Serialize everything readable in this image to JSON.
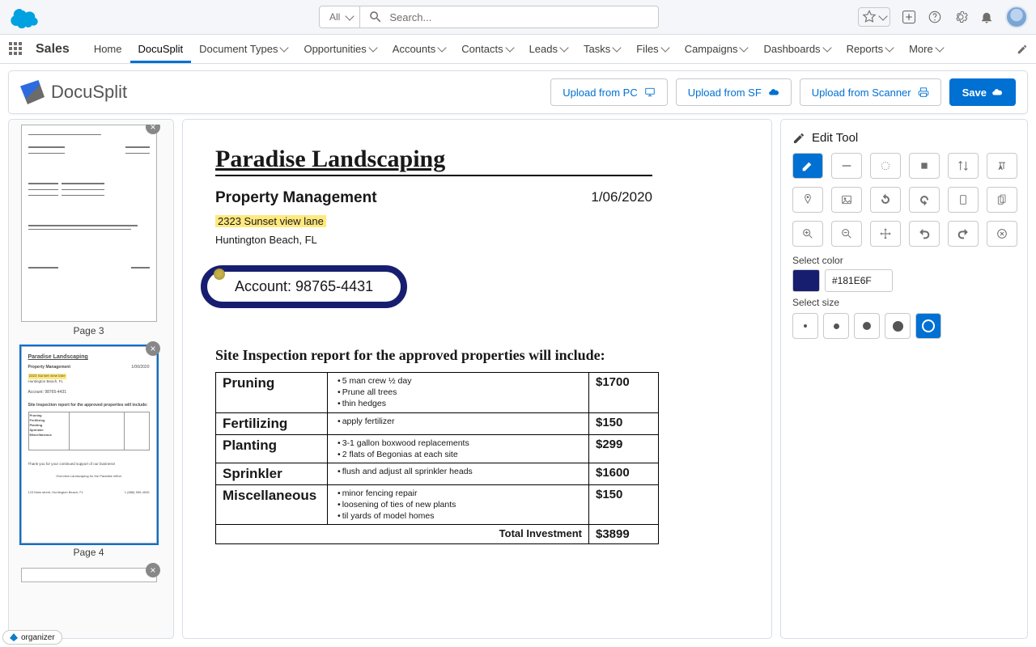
{
  "header": {
    "search_scope": "All",
    "search_placeholder": "Search..."
  },
  "nav": {
    "app": "Sales",
    "tabs": [
      "Home",
      "DocuSplit",
      "Document Types",
      "Opportunities",
      "Accounts",
      "Contacts",
      "Leads",
      "Tasks",
      "Files",
      "Campaigns",
      "Dashboards",
      "Reports",
      "More"
    ],
    "active": "DocuSplit",
    "with_caret": [
      "Document Types",
      "Opportunities",
      "Accounts",
      "Contacts",
      "Leads",
      "Tasks",
      "Files",
      "Campaigns",
      "Dashboards",
      "Reports",
      "More"
    ]
  },
  "appbar": {
    "name": "DocuSplit",
    "upload_pc": "Upload from PC",
    "upload_sf": "Upload from SF",
    "upload_scan": "Upload from Scanner",
    "save": "Save"
  },
  "thumbs": {
    "pages": [
      {
        "caption": "Page 3"
      },
      {
        "caption": "Page 4"
      }
    ]
  },
  "document": {
    "title": "Paradise Landscaping",
    "subtitle": "Property Management",
    "date": "1/06/2020",
    "address_line1": "2323 Sunset view lane",
    "address_line2": "Huntington Beach, FL",
    "account": "Account: 98765-4431",
    "report_heading": "Site Inspection report for the approved properties will include:",
    "rows": [
      {
        "label": "Pruning",
        "details": [
          "5 man crew ½ day",
          "Prune all trees",
          "thin hedges"
        ],
        "price": "$1700"
      },
      {
        "label": "Fertilizing",
        "details": [
          "apply fertilizer"
        ],
        "price": "$150"
      },
      {
        "label": "Planting",
        "details": [
          "3-1 gallon boxwood replacements",
          "2 flats of Begonias at each site"
        ],
        "price": "$299"
      },
      {
        "label": "Sprinkler",
        "details": [
          "flush and adjust all sprinkler heads"
        ],
        "price": "$1600"
      },
      {
        "label": "Miscellaneous",
        "details": [
          "minor fencing repair",
          "loosening of ties of new plants",
          "til yards of model homes"
        ],
        "price": "$150"
      }
    ],
    "total_label": "Total Investment",
    "total_value": "$3899"
  },
  "tools": {
    "title": "Edit Tool",
    "color_label": "Select color",
    "color_hex": "#181E6F",
    "size_label": "Select size"
  },
  "organizer": {
    "label": "organizer"
  }
}
